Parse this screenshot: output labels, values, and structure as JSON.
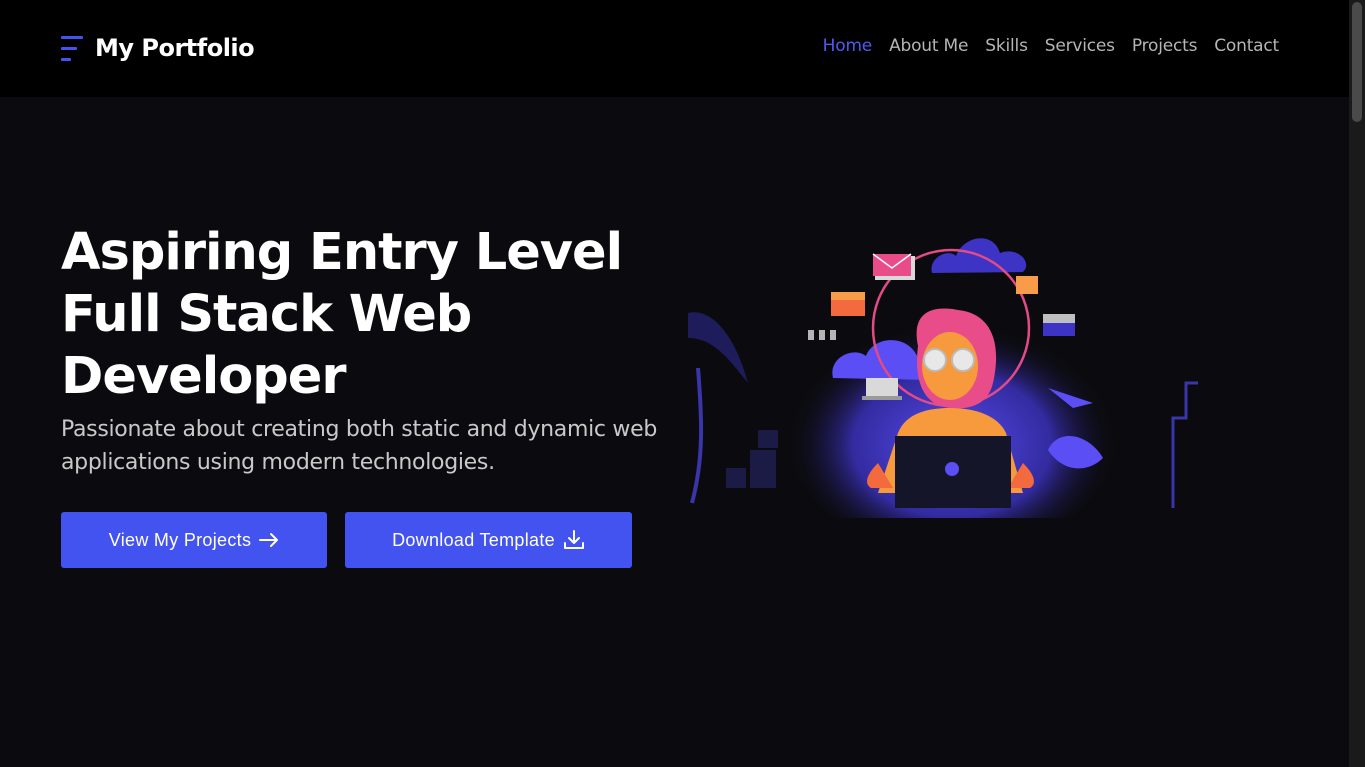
{
  "header": {
    "logo_text": "My Portfolio",
    "nav": [
      {
        "label": "Home",
        "active": true
      },
      {
        "label": "About Me"
      },
      {
        "label": "Skills"
      },
      {
        "label": "Services"
      },
      {
        "label": "Projects"
      },
      {
        "label": "Contact"
      }
    ]
  },
  "hero": {
    "title_line1": "Aspiring Entry Level",
    "title_line2": "Full Stack Web",
    "title_line3": "Developer",
    "subtitle": "Passionate about creating both static and dynamic web applications using modern technologies.",
    "primary_button": "View My Projects",
    "secondary_button": "Download Template"
  },
  "colors": {
    "accent": "#4353f0",
    "header_bg": "#000000",
    "page_bg": "#0b0b0f",
    "nav_active": "#4f5bf0"
  },
  "icons": {
    "primary_button": "arrow-right-icon",
    "secondary_button": "download-icon",
    "logo": "menu-lines-icon"
  }
}
